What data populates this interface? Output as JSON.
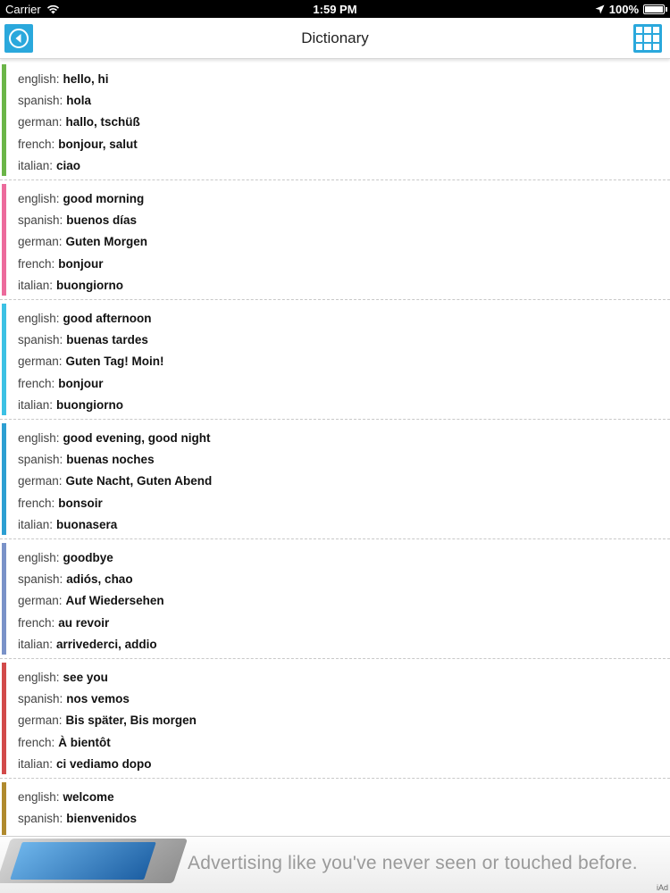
{
  "status_bar": {
    "carrier": "Carrier",
    "time": "1:59 PM",
    "battery": "100%"
  },
  "nav": {
    "title": "Dictionary"
  },
  "entries": [
    {
      "color": "#6bb548",
      "rows": [
        {
          "lang": "english:",
          "word": "hello, hi"
        },
        {
          "lang": "spanish:",
          "word": "hola"
        },
        {
          "lang": "german:",
          "word": "hallo, tschüß"
        },
        {
          "lang": "french:",
          "word": "bonjour, salut"
        },
        {
          "lang": "italian:",
          "word": "ciao"
        }
      ]
    },
    {
      "color": "#ec6b9c",
      "rows": [
        {
          "lang": "english:",
          "word": "good morning"
        },
        {
          "lang": "spanish:",
          "word": "buenos días"
        },
        {
          "lang": "german:",
          "word": "Guten Morgen"
        },
        {
          "lang": "french:",
          "word": "bonjour"
        },
        {
          "lang": "italian:",
          "word": "buongiorno"
        }
      ]
    },
    {
      "color": "#3cc1e4",
      "rows": [
        {
          "lang": "english:",
          "word": "good afternoon"
        },
        {
          "lang": "spanish:",
          "word": "buenas tardes"
        },
        {
          "lang": "german:",
          "word": "Guten Tag! Moin!"
        },
        {
          "lang": "french:",
          "word": "bonjour"
        },
        {
          "lang": "italian:",
          "word": "buongiorno"
        }
      ]
    },
    {
      "color": "#2d9fd2",
      "rows": [
        {
          "lang": "english:",
          "word": "good evening, good night"
        },
        {
          "lang": "spanish:",
          "word": "buenas noches"
        },
        {
          "lang": "german:",
          "word": "Gute Nacht, Guten Abend"
        },
        {
          "lang": "french:",
          "word": "bonsoir"
        },
        {
          "lang": "italian:",
          "word": "buonasera"
        }
      ]
    },
    {
      "color": "#7a92c8",
      "rows": [
        {
          "lang": "english:",
          "word": "goodbye"
        },
        {
          "lang": "spanish:",
          "word": "adiós, chao"
        },
        {
          "lang": "german:",
          "word": "Auf Wiedersehen"
        },
        {
          "lang": "french:",
          "word": "au revoir"
        },
        {
          "lang": "italian:",
          "word": "arrivederci, addio"
        }
      ]
    },
    {
      "color": "#d24a4a",
      "rows": [
        {
          "lang": "english:",
          "word": "see you"
        },
        {
          "lang": "spanish:",
          "word": "nos vemos"
        },
        {
          "lang": "german:",
          "word": "Bis später, Bis morgen"
        },
        {
          "lang": "french:",
          "word": "À bientôt"
        },
        {
          "lang": "italian:",
          "word": "ci vediamo dopo"
        }
      ]
    },
    {
      "color": "#b08a2e",
      "rows": [
        {
          "lang": "english:",
          "word": "welcome"
        },
        {
          "lang": "spanish:",
          "word": "bienvenidos"
        },
        {
          "lang": "",
          "word": "...."
        }
      ]
    }
  ],
  "ad": {
    "text": "Advertising like you've never seen or touched before.",
    "label": "iAd"
  }
}
